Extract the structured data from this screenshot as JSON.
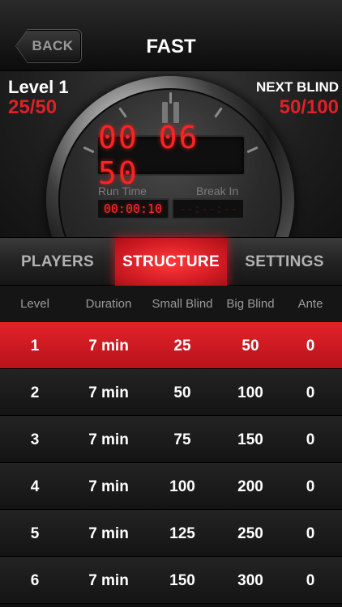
{
  "nav": {
    "back_label": "BACK",
    "title": "FAST"
  },
  "timer": {
    "level_label": "Level 1",
    "current_blinds": "25/50",
    "next_label": "NEXT BLIND",
    "next_blinds": "50/100",
    "main_time": "00 06 50",
    "run_time_label": "Run Time",
    "break_in_label": "Break In",
    "run_time_value": "00:00:10",
    "break_in_value": "--:--:--",
    "accent_color": "#e01f26"
  },
  "tabs": [
    {
      "label": "PLAYERS",
      "active": false
    },
    {
      "label": "STRUCTURE",
      "active": true
    },
    {
      "label": "SETTINGS",
      "active": false
    }
  ],
  "table": {
    "columns": [
      "Level",
      "Duration",
      "Small Blind",
      "Big Blind",
      "Ante"
    ],
    "rows": [
      [
        "1",
        "7 min",
        "25",
        "50",
        "0"
      ],
      [
        "2",
        "7 min",
        "50",
        "100",
        "0"
      ],
      [
        "3",
        "7 min",
        "75",
        "150",
        "0"
      ],
      [
        "4",
        "7 min",
        "100",
        "200",
        "0"
      ],
      [
        "5",
        "7 min",
        "125",
        "250",
        "0"
      ],
      [
        "6",
        "7 min",
        "150",
        "300",
        "0"
      ]
    ],
    "active_row": 0
  }
}
